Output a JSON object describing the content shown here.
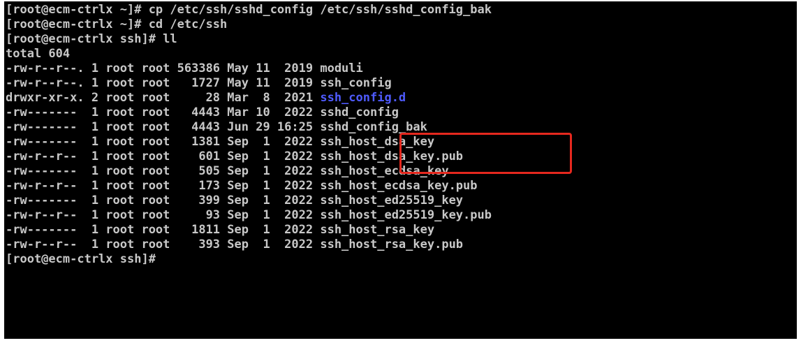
{
  "terminal": {
    "lines": [
      "[root@ecm-ctrlx ~]# cp /etc/ssh/sshd_config /etc/ssh/sshd_config_bak",
      "[root@ecm-ctrlx ~]# cd /etc/ssh",
      "[root@ecm-ctrlx ssh]# ll",
      "total 604"
    ],
    "listing": [
      {
        "meta": "-rw-r--r--. 1 root root 563386 May 11  2019 ",
        "name": "moduli"
      },
      {
        "meta": "-rw-r--r--. 1 root root   1727 May 11  2019 ",
        "name": "ssh_config"
      },
      {
        "meta": "drwxr-xr-x. 2 root root     28 Mar  8  2021 ",
        "name": "ssh_config.d",
        "is_dir": true
      },
      {
        "meta": "-rw-------  1 root root   4443 Mar 10  2022 ",
        "name": "sshd_config"
      },
      {
        "meta": "-rw-------  1 root root   4443 Jun 29 16:25 ",
        "name": "sshd_config_bak"
      },
      {
        "meta": "-rw-------  1 root root   1381 Sep  1  2022 ",
        "name": "ssh_host_dsa_key"
      },
      {
        "meta": "-rw-r--r--  1 root root    601 Sep  1  2022 ",
        "name": "ssh_host_dsa_key.pub"
      },
      {
        "meta": "-rw-------  1 root root    505 Sep  1  2022 ",
        "name": "ssh_host_ecdsa_key"
      },
      {
        "meta": "-rw-r--r--  1 root root    173 Sep  1  2022 ",
        "name": "ssh_host_ecdsa_key.pub"
      },
      {
        "meta": "-rw-------  1 root root    399 Sep  1  2022 ",
        "name": "ssh_host_ed25519_key"
      },
      {
        "meta": "-rw-r--r--  1 root root     93 Sep  1  2022 ",
        "name": "ssh_host_ed25519_key.pub"
      },
      {
        "meta": "-rw-------  1 root root   1811 Sep  1  2022 ",
        "name": "ssh_host_rsa_key"
      },
      {
        "meta": "-rw-r--r--  1 root root    393 Sep  1  2022 ",
        "name": "ssh_host_rsa_key.pub"
      }
    ],
    "prompt": "[root@ecm-ctrlx ssh]#",
    "colors": {
      "background": "#000000",
      "text": "#c8c8c8",
      "directory": "#4f5bff",
      "highlight_box": "#e5281e"
    }
  }
}
